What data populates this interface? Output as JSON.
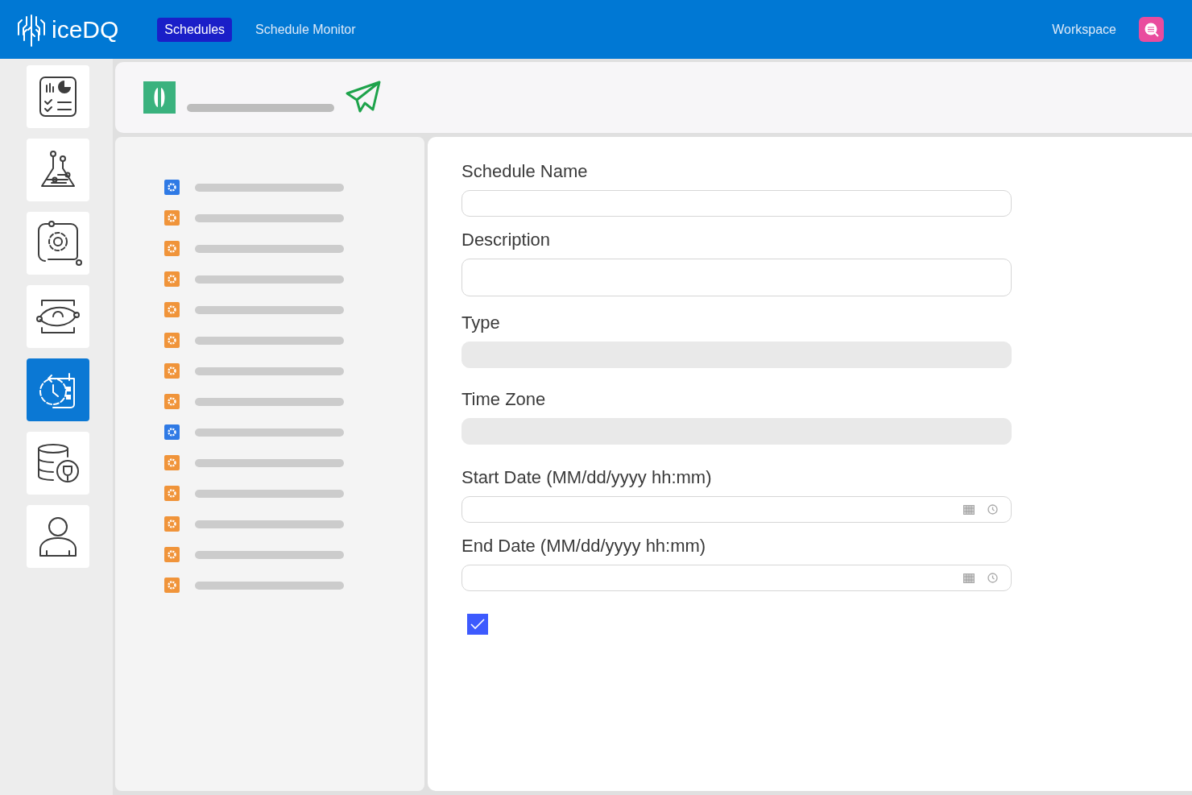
{
  "header": {
    "logo": "iceDQ",
    "tabs": [
      {
        "label": "Schedules",
        "selected": true
      },
      {
        "label": "Schedule Monitor",
        "selected": false
      }
    ],
    "workspace": "Workspace"
  },
  "sidebar": {
    "items": [
      {
        "kind": "report",
        "selected": false
      },
      {
        "kind": "lab",
        "selected": false
      },
      {
        "kind": "settings",
        "selected": false
      },
      {
        "kind": "eye",
        "selected": false
      },
      {
        "kind": "schedule",
        "selected": true
      },
      {
        "kind": "database",
        "selected": false
      },
      {
        "kind": "user",
        "selected": false
      }
    ]
  },
  "tree": {
    "items": [
      {
        "color": "#2f7ae5"
      },
      {
        "color": "#f0943a"
      },
      {
        "color": "#f0943a"
      },
      {
        "color": "#f0943a"
      },
      {
        "color": "#f0943a"
      },
      {
        "color": "#f0943a"
      },
      {
        "color": "#f0943a"
      },
      {
        "color": "#f0943a"
      },
      {
        "color": "#2f7ae5"
      },
      {
        "color": "#f0943a"
      },
      {
        "color": "#f0943a"
      },
      {
        "color": "#f0943a"
      },
      {
        "color": "#f0943a"
      },
      {
        "color": "#f0943a"
      }
    ]
  },
  "form": {
    "fields": [
      {
        "label": "Schedule Name",
        "kind": "text"
      },
      {
        "label": "Description",
        "kind": "textarea"
      },
      {
        "label": "Type",
        "kind": "disabled"
      },
      {
        "label": "Time Zone",
        "kind": "disabled"
      },
      {
        "label": "Start Date (MM/dd/yyyy hh:mm)",
        "kind": "datetime"
      },
      {
        "label": "End Date (MM/dd/yyyy hh:mm)",
        "kind": "datetime"
      }
    ],
    "checkbox": {
      "checked": true
    }
  }
}
